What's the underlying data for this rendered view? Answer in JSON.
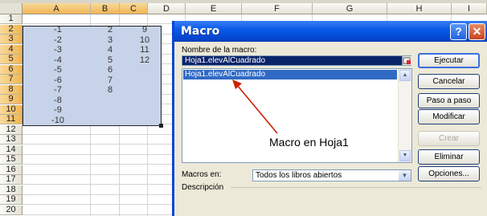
{
  "spreadsheet": {
    "columns": [
      "A",
      "B",
      "C",
      "D",
      "E",
      "F",
      "G",
      "H",
      "I"
    ],
    "rows": [
      "1",
      "2",
      "3",
      "4",
      "5",
      "6",
      "7",
      "8",
      "9",
      "10",
      "11",
      "12",
      "13",
      "14",
      "15",
      "16",
      "17",
      "18",
      "19",
      "20"
    ],
    "col_a": [
      "-1",
      "-2",
      "-3",
      "-4",
      "-5",
      "-6",
      "-7",
      "-8",
      "-9",
      "-10"
    ],
    "col_b": [
      "2",
      "3",
      "4",
      "5",
      "6",
      "7",
      "8"
    ],
    "col_c": [
      "9",
      "10",
      "11",
      "12"
    ]
  },
  "dialog": {
    "title": "Macro",
    "help_glyph": "?",
    "close_glyph": "✕",
    "name_label": "Nombre de la macro:",
    "name_value": "Hoja1.elevAlCuadrado",
    "list_items": [
      "Hoja1.elevAlCuadrado"
    ],
    "annotation": "Macro en Hoja1",
    "buttons": {
      "run": "Ejecutar",
      "cancel": "Cancelar",
      "step": "Paso a paso",
      "modify": "Modificar",
      "create": "Crear",
      "delete": "Eliminar",
      "options": "Opciones..."
    },
    "macros_in_label": "Macros en:",
    "macros_in_value": "Todos los libros abiertos",
    "description_label": "Descripción"
  },
  "colors": {
    "titlebar": "#0a5ae8",
    "selection": "#c7d3e8",
    "annotation_arrow": "#cc2200"
  }
}
